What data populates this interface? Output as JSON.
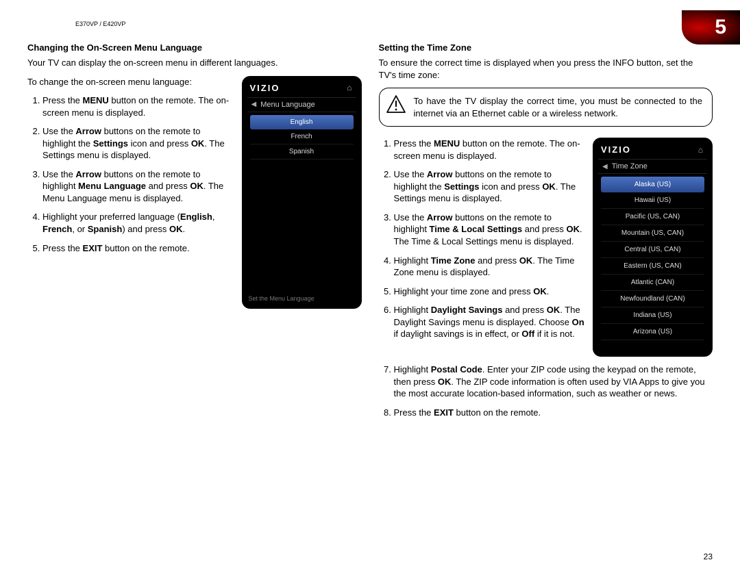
{
  "header": {
    "models": "E370VP / E420VP"
  },
  "chapter": {
    "number": "5"
  },
  "left": {
    "heading": "Changing the On-Screen Menu Language",
    "intro": "Your TV can display the on-screen menu in different languages.",
    "lead": "To change the on-screen menu language:",
    "steps": {
      "s1a": "Press the ",
      "s1b": "MENU",
      "s1c": " button on the remote. The on-screen menu is displayed.",
      "s2a": "Use the ",
      "s2b": "Arrow",
      "s2c": " buttons on the remote to highlight the ",
      "s2d": "Settings",
      "s2e": " icon and press ",
      "s2f": "OK",
      "s2g": ". The Settings menu is displayed.",
      "s3a": "Use the ",
      "s3b": "Arrow",
      "s3c": " buttons on the remote to highlight ",
      "s3d": "Menu Language",
      "s3e": " and press ",
      "s3f": "OK",
      "s3g": ". The Menu Language menu is displayed.",
      "s4a": "Highlight your preferred language (",
      "s4b": "English",
      "s4c": ", ",
      "s4d": "French",
      "s4e": ", or ",
      "s4f": "Spanish",
      "s4g": ") and press ",
      "s4h": "OK",
      "s4i": ".",
      "s5a": "Press the ",
      "s5b": "EXIT",
      "s5c": " button on the remote."
    },
    "tv": {
      "brand": "VIZIO",
      "title": "Menu Language",
      "items": [
        "English",
        "French",
        "Spanish"
      ],
      "hint": "Set the Menu Language"
    }
  },
  "right": {
    "heading": "Setting the Time Zone",
    "intro": "To ensure the correct time is displayed when you press the INFO button, set the TV's time zone:",
    "note": "To have the TV display the correct time, you must be connected to the internet via an Ethernet cable or a wireless network.",
    "steps": {
      "s1a": "Press the ",
      "s1b": "MENU",
      "s1c": " button on the remote. The on-screen menu is displayed.",
      "s2a": "Use the ",
      "s2b": "Arrow",
      "s2c": " buttons on the remote to highlight the ",
      "s2d": "Settings",
      "s2e": " icon and press ",
      "s2f": "OK",
      "s2g": ". The Settings menu is displayed.",
      "s3a": "Use the ",
      "s3b": "Arrow",
      "s3c": " buttons on the remote to highlight ",
      "s3d": "Time & Local Settings",
      "s3e": " and press ",
      "s3f": "OK",
      "s3g": ". The Time & Local Settings menu is displayed.",
      "s4a": "Highlight ",
      "s4b": "Time Zone",
      "s4c": " and press ",
      "s4d": "OK",
      "s4e": ". The Time Zone menu is displayed.",
      "s5a": "Highlight your time zone and press ",
      "s5b": "OK",
      "s5c": ".",
      "s6a": "Highlight ",
      "s6b": "Daylight Savings",
      "s6c": " and press ",
      "s6d": "OK",
      "s6e": ". The Daylight Savings menu is displayed. Choose ",
      "s6f": "On",
      "s6g": " if daylight savings is in effect, or ",
      "s6h": "Off",
      "s6i": " if it is not.",
      "s7a": "Highlight ",
      "s7b": "Postal Code",
      "s7c": ". Enter your ZIP code using the keypad on the remote, then press ",
      "s7d": "OK",
      "s7e": ". The ZIP code information is often used by VIA Apps to give you the most accurate location-based information, such as weather or news.",
      "s8a": "Press the ",
      "s8b": "EXIT",
      "s8c": " button on the remote."
    },
    "tv": {
      "brand": "VIZIO",
      "title": "Time Zone",
      "items": [
        "Alaska (US)",
        "Hawaii (US)",
        "Pacific (US, CAN)",
        "Mountain (US, CAN)",
        "Central (US, CAN)",
        "Eastern (US, CAN)",
        "Atlantic (CAN)",
        "Newfoundland (CAN)",
        "Indiana (US)",
        "Arizona (US)"
      ]
    }
  },
  "page_number": "23"
}
